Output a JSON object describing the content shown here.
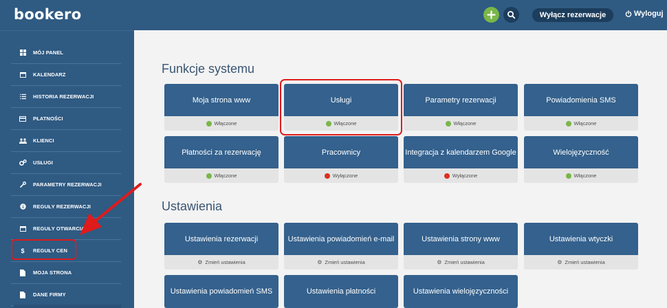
{
  "header": {
    "logo": "bookero",
    "toggle_label": "Wyłącz rezerwacje",
    "logout_label": "Wyloguj",
    "accent_green": "#7ab648",
    "brand_blue": "#2f5a82"
  },
  "sidebar": {
    "items": [
      {
        "label": "MÓJ PANEL",
        "icon": "dashboard-icon"
      },
      {
        "label": "KALENDARZ",
        "icon": "calendar-icon"
      },
      {
        "label": "HISTORIA REZERWACJI",
        "icon": "history-icon"
      },
      {
        "label": "PŁATNOŚCI",
        "icon": "credit-card-icon"
      },
      {
        "label": "KLIENCI",
        "icon": "users-icon"
      },
      {
        "label": "USŁUGI",
        "icon": "cogs-icon"
      },
      {
        "label": "PARAMETRY REZERWACJI",
        "icon": "wrench-icon"
      },
      {
        "label": "REGUŁY REZERWACJI",
        "icon": "info-icon"
      },
      {
        "label": "REGUŁY OTWARCIA",
        "icon": "calendar-icon"
      },
      {
        "label": "REGUŁY CEN",
        "icon": "dollar-icon"
      },
      {
        "label": "MOJA STRONA",
        "icon": "page-icon"
      },
      {
        "label": "DANE FIRMY",
        "icon": "file-icon"
      }
    ]
  },
  "features": {
    "title": "Funkcje systemu",
    "tiles": [
      {
        "label": "Moja strona www",
        "status": "Włączone",
        "status_color": "#7ab648"
      },
      {
        "label": "Usługi",
        "status": "Włączone",
        "status_color": "#7ab648"
      },
      {
        "label": "Parametry rezerwacji",
        "status": "Włączone",
        "status_color": "#7ab648"
      },
      {
        "label": "Powiadomienia SMS",
        "status": "Włączone",
        "status_color": "#7ab648"
      },
      {
        "label": "Płatności za rezerwację",
        "status": "Włączone",
        "status_color": "#7ab648"
      },
      {
        "label": "Pracownicy",
        "status": "Wyłączone",
        "status_color": "#d9321f"
      },
      {
        "label": "Integracja z kalendarzem Google",
        "status": "Wyłączone",
        "status_color": "#d9321f"
      },
      {
        "label": "Wielojęzyczność",
        "status": "Włączone",
        "status_color": "#7ab648"
      }
    ]
  },
  "settings": {
    "title": "Ustawienia",
    "action_label": "Zmień ustawienia",
    "tiles": [
      {
        "label": "Ustawienia rezerwacji"
      },
      {
        "label": "Ustawienia powiadomień e-mail"
      },
      {
        "label": "Ustawienia strony www"
      },
      {
        "label": "Ustawienia wtyczki"
      },
      {
        "label": "Ustawienia powiadomień SMS"
      },
      {
        "label": "Ustawienia płatności"
      },
      {
        "label": "Ustawienia wielojęzyczności"
      }
    ]
  }
}
